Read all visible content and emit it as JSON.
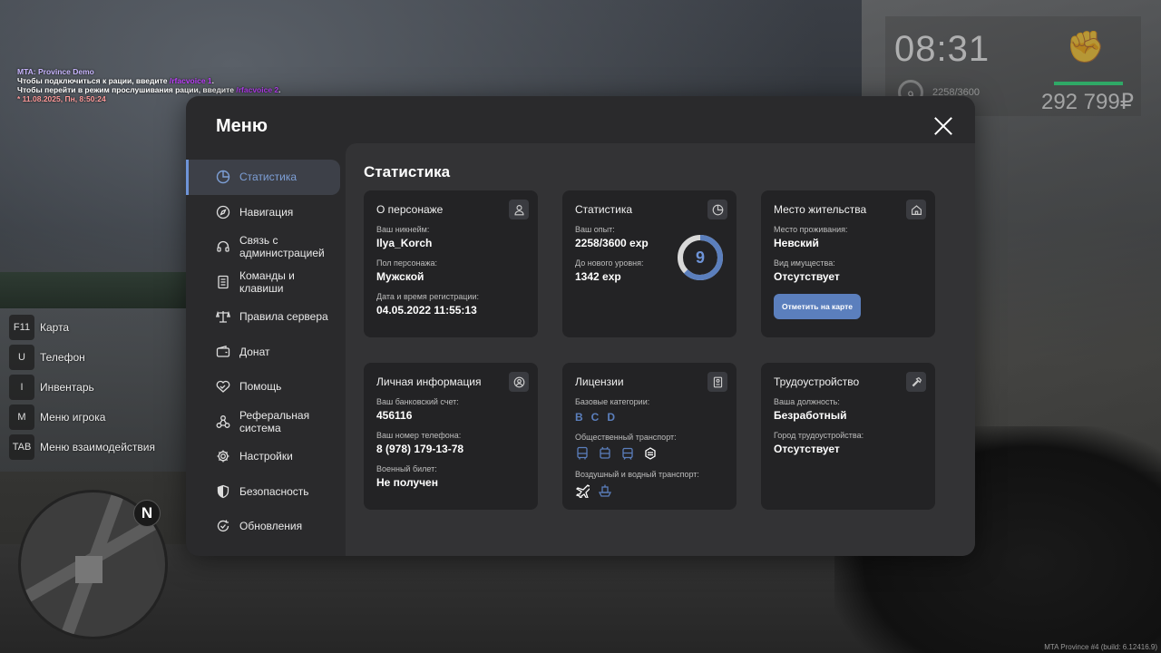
{
  "chat": {
    "line1": "MTA: Province Demo",
    "line2_a": "Чтобы подключиться к рации, введите ",
    "line2_cmd": "/rfacvoice 1",
    "line2_b": ".",
    "line3_a": "Чтобы перейти в режим прослушивания рации, введите ",
    "line3_cmd": "/rfacvoice 2",
    "line3_b": ".",
    "line4": "* 11.08.2025, Пн, 8:50:24"
  },
  "hud": {
    "time": "08:31",
    "level": "9",
    "exp": "2258/3600",
    "money": "292 799₽",
    "health_color": "#2fa866"
  },
  "keybinds": [
    {
      "key": "F11",
      "label": "Карта"
    },
    {
      "key": "U",
      "label": "Телефон"
    },
    {
      "key": "I",
      "label": "Инвентарь"
    },
    {
      "key": "M",
      "label": "Меню игрока"
    },
    {
      "key": "TAB",
      "label": "Меню взаимодействия"
    }
  ],
  "minimap": {
    "north": "N"
  },
  "build": "MTA Province #4 (build: 6.12416.9)",
  "menu": {
    "title": "Меню",
    "nav": [
      {
        "label": "Статистика",
        "icon": "pie-chart-icon",
        "active": true
      },
      {
        "label": "Навигация",
        "icon": "compass-icon"
      },
      {
        "label": "Связь с администрацией",
        "icon": "headset-icon"
      },
      {
        "label": "Команды и клавиши",
        "icon": "document-icon"
      },
      {
        "label": "Правила сервера",
        "icon": "scales-icon"
      },
      {
        "label": "Донат",
        "icon": "wallet-icon"
      },
      {
        "label": "Помощь",
        "icon": "handshake-icon"
      },
      {
        "label": "Реферальная система",
        "icon": "network-icon"
      },
      {
        "label": "Настройки",
        "icon": "gear-icon"
      },
      {
        "label": "Безопасность",
        "icon": "shield-icon"
      },
      {
        "label": "Обновления",
        "icon": "refresh-icon"
      }
    ]
  },
  "content": {
    "title": "Статистика",
    "character": {
      "title": "О персонаже",
      "nick_label": "Ваш никнейм:",
      "nick": "Ilya_Korch",
      "gender_label": "Пол персонажа:",
      "gender": "Мужской",
      "reg_label": "Дата и время регистрации:",
      "reg": "04.05.2022 11:55:13"
    },
    "stats": {
      "title": "Статистика",
      "exp_label": "Ваш опыт:",
      "exp": "2258/3600 exp",
      "next_label": "До нового уровня:",
      "next": "1342 exp",
      "level": "9",
      "progress": 0.627,
      "ring_color": "#5b7fbd"
    },
    "residence": {
      "title": "Место жительства",
      "place_label": "Место проживания:",
      "place": "Невский",
      "property_label": "Вид имущества:",
      "property": "Отсутствует",
      "button": "Отметить на карте"
    },
    "personal": {
      "title": "Личная информация",
      "bank_label": "Ваш банковский счет:",
      "bank": "456116",
      "phone_label": "Ваш номер телефона:",
      "phone": "8 (978) 179-13-78",
      "military_label": "Военный билет:",
      "military": "Не получен"
    },
    "licenses": {
      "title": "Лицензии",
      "base_label": "Базовые категории:",
      "categories": [
        "B",
        "C",
        "D"
      ],
      "public_label": "Общественный транспорт:",
      "air_label": "Воздушный и водный транспорт:"
    },
    "job": {
      "title": "Трудоустройство",
      "position_label": "Ваша должность:",
      "position": "Безработный",
      "city_label": "Город трудоустройства:",
      "city": "Отсутствует"
    }
  }
}
